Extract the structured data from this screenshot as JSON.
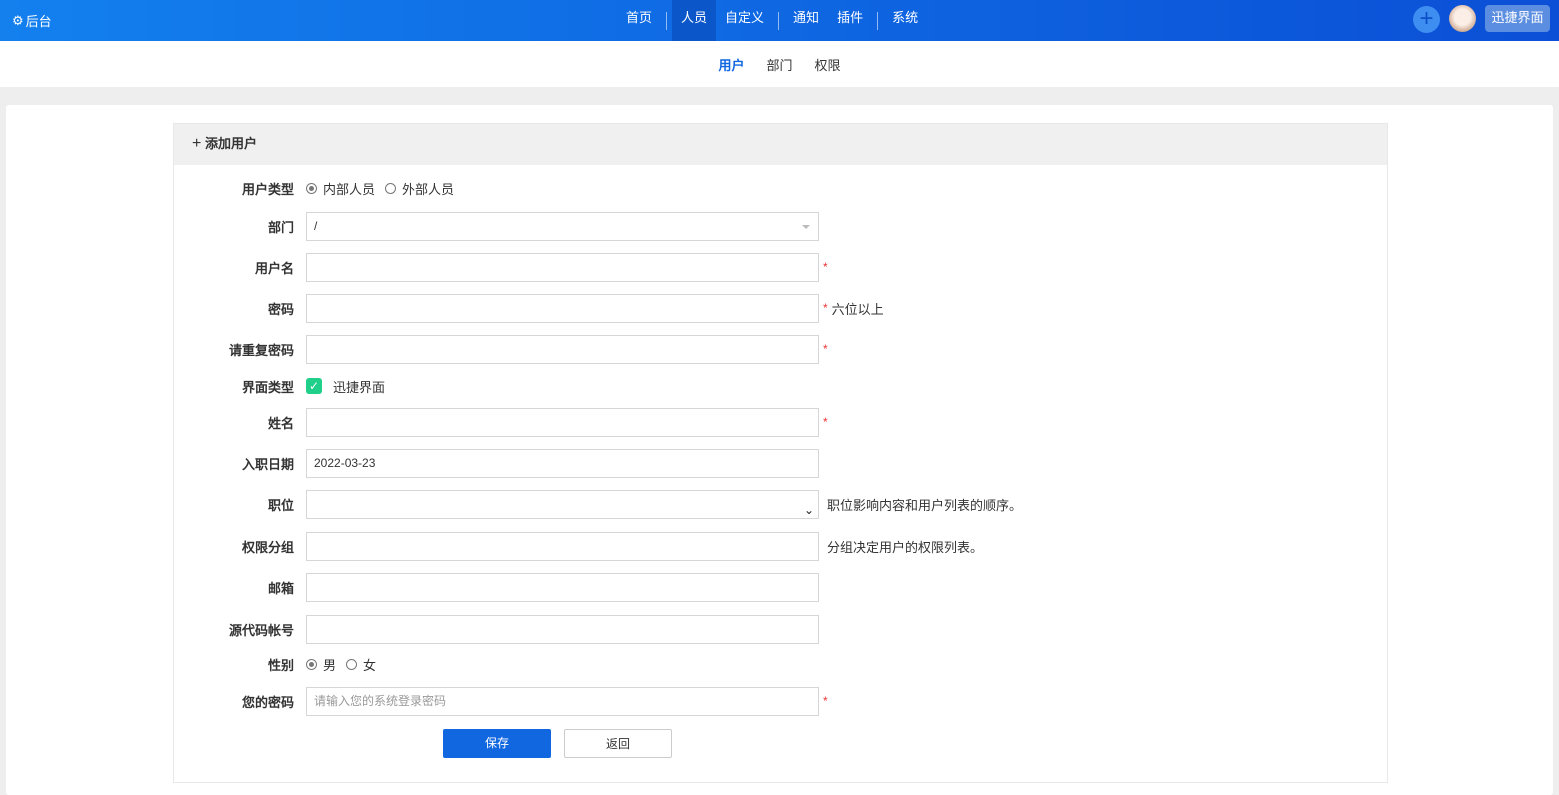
{
  "header": {
    "brand": "后台",
    "nav": [
      "首页",
      "人员",
      "自定义",
      "通知",
      "插件",
      "系统"
    ],
    "active_nav": "人员",
    "quick_label": "迅捷界面"
  },
  "subnav": {
    "items": [
      "用户",
      "部门",
      "权限"
    ],
    "active": "用户"
  },
  "panel": {
    "title": "添加用户"
  },
  "form": {
    "user_type": {
      "label": "用户类型",
      "options": [
        "内部人员",
        "外部人员"
      ],
      "selected": "内部人员"
    },
    "dept": {
      "label": "部门",
      "value": "/"
    },
    "username": {
      "label": "用户名",
      "value": "",
      "required": "*"
    },
    "password": {
      "label": "密码",
      "value": "",
      "required": "*",
      "hint": "六位以上"
    },
    "password2": {
      "label": "请重复密码",
      "value": "",
      "required": "*"
    },
    "ui_type": {
      "label": "界面类型",
      "option": "迅捷界面",
      "checked": true
    },
    "name": {
      "label": "姓名",
      "value": "",
      "required": "*"
    },
    "join_date": {
      "label": "入职日期",
      "value": "2022-03-23"
    },
    "position": {
      "label": "职位",
      "value": "",
      "hint": "职位影响内容和用户列表的顺序。"
    },
    "perm_group": {
      "label": "权限分组",
      "value": "",
      "hint": "分组决定用户的权限列表。"
    },
    "email": {
      "label": "邮箱",
      "value": ""
    },
    "code_account": {
      "label": "源代码帐号",
      "value": ""
    },
    "gender": {
      "label": "性别",
      "options": [
        "男",
        "女"
      ],
      "selected": "男"
    },
    "my_password": {
      "label": "您的密码",
      "placeholder": "请输入您的系统登录密码",
      "required": "*"
    },
    "save_label": "保存",
    "back_label": "返回"
  }
}
